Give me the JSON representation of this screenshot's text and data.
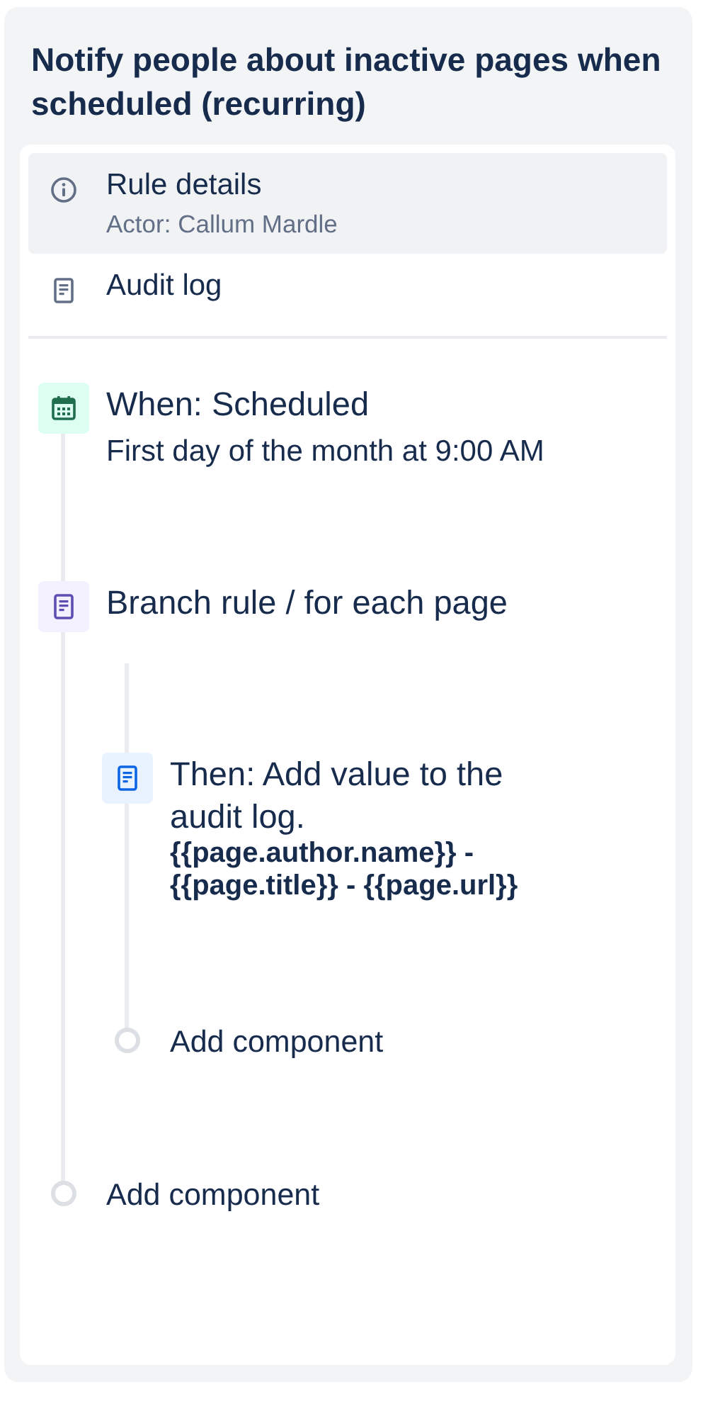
{
  "title": "Notify people about inactive pages when scheduled (recurring)",
  "menu": [
    {
      "kind": "info",
      "label": "Rule details",
      "subtitle": "Actor: Callum Mardle",
      "selected": true
    },
    {
      "kind": "log",
      "label": "Audit log",
      "selected": false
    }
  ],
  "steps": [
    {
      "kind": "trigger",
      "title": "When: Scheduled",
      "detail": "First day of the month at 9:00 AM"
    },
    {
      "kind": "branch",
      "title": "Branch rule / for each page",
      "children": [
        {
          "kind": "action",
          "title": "Then: Add value to the audit log.",
          "detail": "{{page.author.name}} - {{page.title}} - {{page.url}}"
        },
        {
          "kind": "add",
          "title": "Add component"
        }
      ]
    },
    {
      "kind": "add",
      "title": "Add component"
    }
  ]
}
